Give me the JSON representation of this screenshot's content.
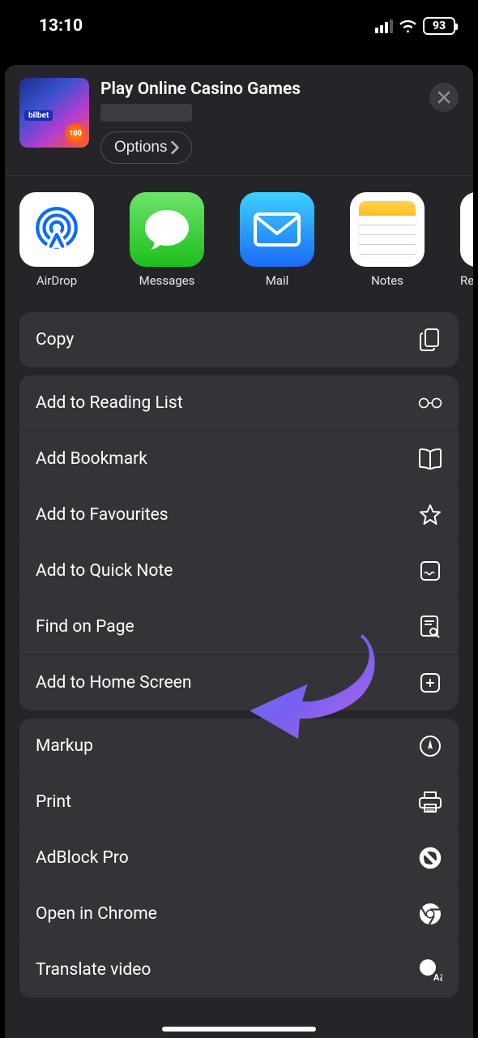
{
  "status": {
    "time": "13:10",
    "battery": "93"
  },
  "share": {
    "title": "Play Online Casino Games",
    "thumb_badge": "bilbet",
    "thumb_chip": "100",
    "options_label": "Options"
  },
  "apps": {
    "airdrop": "AirDrop",
    "messages": "Messages",
    "mail": "Mail",
    "notes": "Notes",
    "reminders": "Rem"
  },
  "actions": {
    "copy": "Copy",
    "reading_list": "Add to Reading List",
    "bookmark": "Add Bookmark",
    "favourites": "Add to Favourites",
    "quick_note": "Add to Quick Note",
    "find": "Find on Page",
    "home_screen": "Add to Home Screen",
    "markup": "Markup",
    "print": "Print",
    "adblock": "AdBlock Pro",
    "chrome": "Open in Chrome",
    "translate": "Translate video"
  }
}
